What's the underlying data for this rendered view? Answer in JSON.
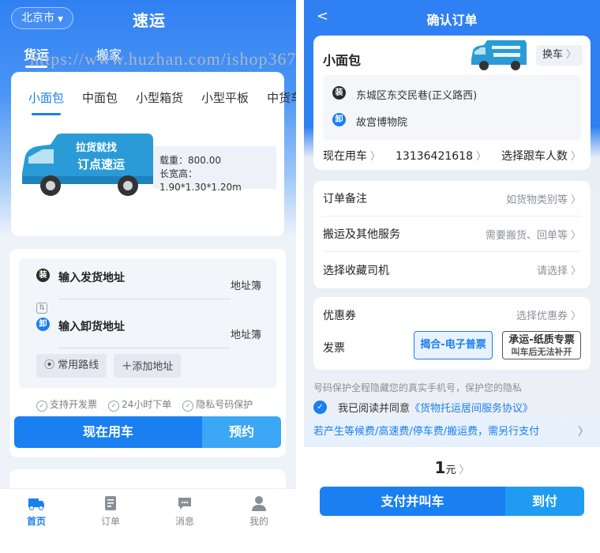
{
  "left": {
    "city": "北京市",
    "brand": "速运",
    "top_tabs": [
      "货运",
      "搬家"
    ],
    "vehicle_tabs": [
      "小面包",
      "中面包",
      "小型箱货",
      "小型平板",
      "中货车"
    ],
    "van_text": {
      "line1": "拉货就找",
      "line2": "订点速运"
    },
    "spec": {
      "load": "载重：800.00",
      "size": "长宽高：1.90*1.30*1.20m"
    },
    "address": {
      "from_badge": "装",
      "from_text": "输入发货地址",
      "to_badge": "卸",
      "to_text": "输入卸货地址",
      "book": "地址簿",
      "chip_routes": "常用路线",
      "chip_add": "添加地址"
    },
    "features": [
      "支持开发票",
      "24小时下单",
      "隐私号码保护"
    ],
    "btn_now": "现在用车",
    "btn_book": "预约",
    "tabbar": [
      "首页",
      "订单",
      "消息",
      "我的"
    ],
    "watermark": "https://www.huzhan.com/ishop36712"
  },
  "right": {
    "title": "确认订单",
    "vehicle": "小面包",
    "change_car": "换车",
    "from_badge": "装",
    "from": "东城区东交民巷(正义路西)",
    "to_badge": "卸",
    "to": "故宫博物院",
    "time": "现在用车",
    "phone": "13136421618",
    "followers": "选择跟车人数",
    "options": [
      {
        "label": "订单备注",
        "value": "如货物类别等"
      },
      {
        "label": "搬运及其他服务",
        "value": "需要搬货、回单等"
      },
      {
        "label": "选择收藏司机",
        "value": "请选择"
      }
    ],
    "coupon": {
      "label": "优惠券",
      "value": "选择优惠券"
    },
    "invoice": {
      "label": "发票",
      "option_a": "揭合-电子普票",
      "option_b": "承运-纸质专票",
      "option_b_sub": "叫车后无法补开"
    },
    "privacy": "号码保护全程隐藏您的真实手机号，保护您的隐私",
    "agree_prefix": "我已阅读并同意",
    "agree_link": "《货物托运居间服务协议》",
    "notice": "若产生等候费/高速费/停车费/搬运费，需另行支付",
    "price_value": "1",
    "price_unit": "元",
    "pay_now": "支付并叫车",
    "pay_later": "到付"
  },
  "colors": {
    "primary": "#1a7ff0",
    "secondary": "#3ba7f5"
  }
}
